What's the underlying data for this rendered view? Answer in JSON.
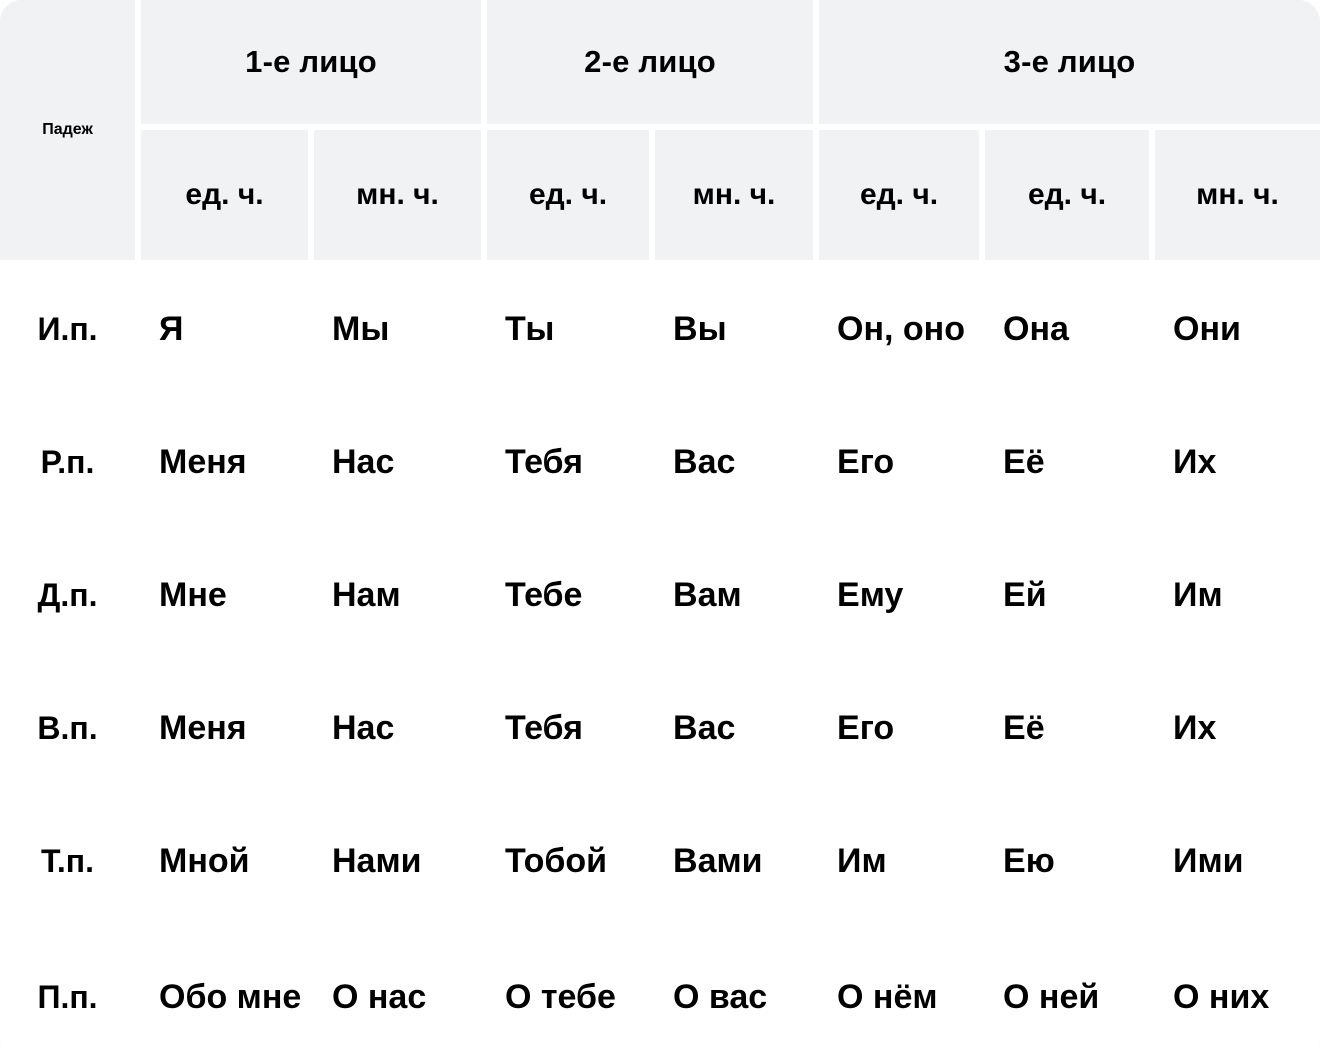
{
  "table": {
    "case_column_header": "Падеж",
    "person_groups": [
      {
        "label": "1-е лицо",
        "columns": [
          "ед. ч.",
          "мн. ч."
        ]
      },
      {
        "label": "2-е лицо",
        "columns": [
          "ед. ч.",
          "мн. ч."
        ]
      },
      {
        "label": "3-е лицо",
        "columns": [
          "ед. ч.",
          "ед. ч.",
          "мн. ч."
        ]
      }
    ],
    "column_headers": [
      "ед. ч.",
      "мн. ч.",
      "ед. ч.",
      "мн. ч.",
      "ед. ч.",
      "ед. ч.",
      "мн. ч."
    ],
    "rows": [
      {
        "case": "И.п.",
        "cells": [
          "Я",
          "Мы",
          "Ты",
          "Вы",
          "Он, оно",
          "Она",
          "Они"
        ]
      },
      {
        "case": "Р.п.",
        "cells": [
          "Меня",
          "Нас",
          "Тебя",
          "Вас",
          "Его",
          "Её",
          "Их"
        ]
      },
      {
        "case": "Д.п.",
        "cells": [
          "Мне",
          "Нам",
          "Тебе",
          "Вам",
          "Ему",
          "Ей",
          "Им"
        ]
      },
      {
        "case": "В.п.",
        "cells": [
          "Меня",
          "Нас",
          "Тебя",
          "Вас",
          "Его",
          "Её",
          "Их"
        ]
      },
      {
        "case": "Т.п.",
        "cells": [
          "Мной",
          "Нами",
          "Тобой",
          "Вами",
          "Им",
          "Ею",
          "Ими"
        ]
      },
      {
        "case": "П.п.",
        "cells": [
          "Обо мне",
          "О нас",
          "О тебе",
          "О вас",
          "О нём",
          "О ней",
          "О них"
        ]
      }
    ]
  },
  "colors": {
    "header_background": "#F1F2F4",
    "body_background": "#FFFFFF",
    "grid_line": "#E2E6EB",
    "header_divider": "#DFE3E8",
    "text": "#000000"
  }
}
